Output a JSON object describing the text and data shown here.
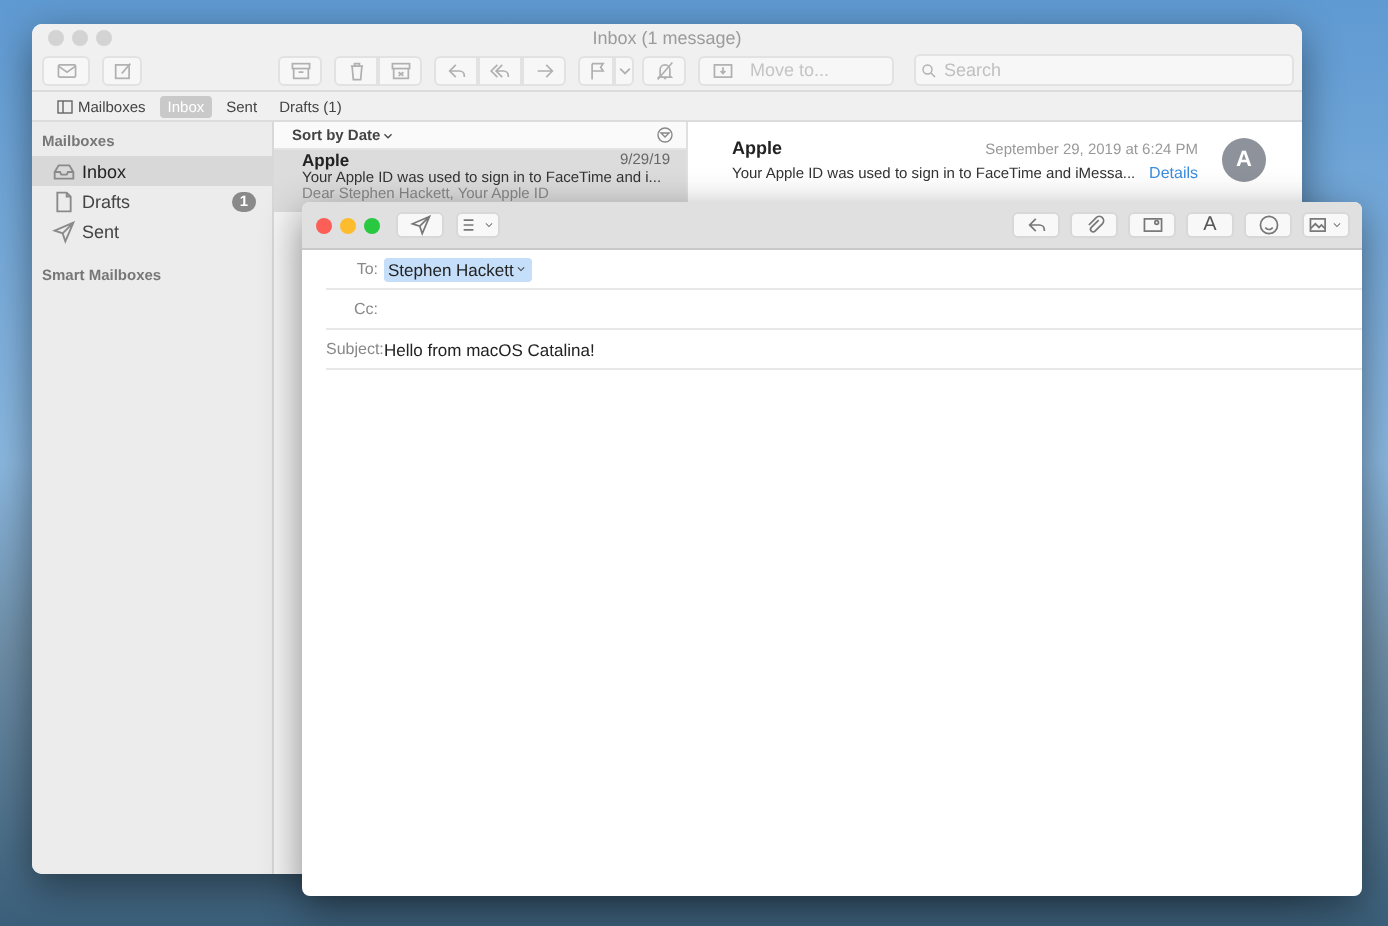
{
  "main_window": {
    "title": "Inbox (1 message)",
    "move_to": {
      "placeholder": "Move to..."
    },
    "search": {
      "placeholder": "Search"
    },
    "mailboxes_button": "Mailboxes",
    "favorites": [
      {
        "label": "Inbox",
        "selected": true
      },
      {
        "label": "Sent",
        "selected": false
      },
      {
        "label": "Drafts (1)",
        "selected": false
      }
    ],
    "sidebar": {
      "heading": "Mailboxes",
      "items": [
        {
          "label": "Inbox",
          "kind": "inbox",
          "selected": true
        },
        {
          "label": "Drafts",
          "kind": "drafts",
          "selected": false,
          "badge": "1"
        },
        {
          "label": "Sent",
          "kind": "sent",
          "selected": false
        }
      ],
      "smart_heading": "Smart Mailboxes"
    },
    "message_list": {
      "sort": "Sort by Date",
      "messages": [
        {
          "sender": "Apple",
          "date": "9/29/19",
          "subject": "Your Apple ID was used to sign in to FaceTime and i...",
          "preview": "Dear Stephen Hackett, Your Apple ID",
          "selected": true
        }
      ]
    },
    "message": {
      "sender": "Apple",
      "date": "September 29, 2019 at 6:24 PM",
      "subject": "Your Apple ID was used to sign in to FaceTime and iMessa...",
      "details": "Details",
      "avatar": "A"
    }
  },
  "compose_window": {
    "format_button": "A",
    "to_label": "To:",
    "recipients": [
      {
        "name": "Stephen Hackett"
      }
    ],
    "cc_label": "Cc:",
    "subject_label": "Subject:",
    "subject": "Hello from macOS Catalina!"
  }
}
